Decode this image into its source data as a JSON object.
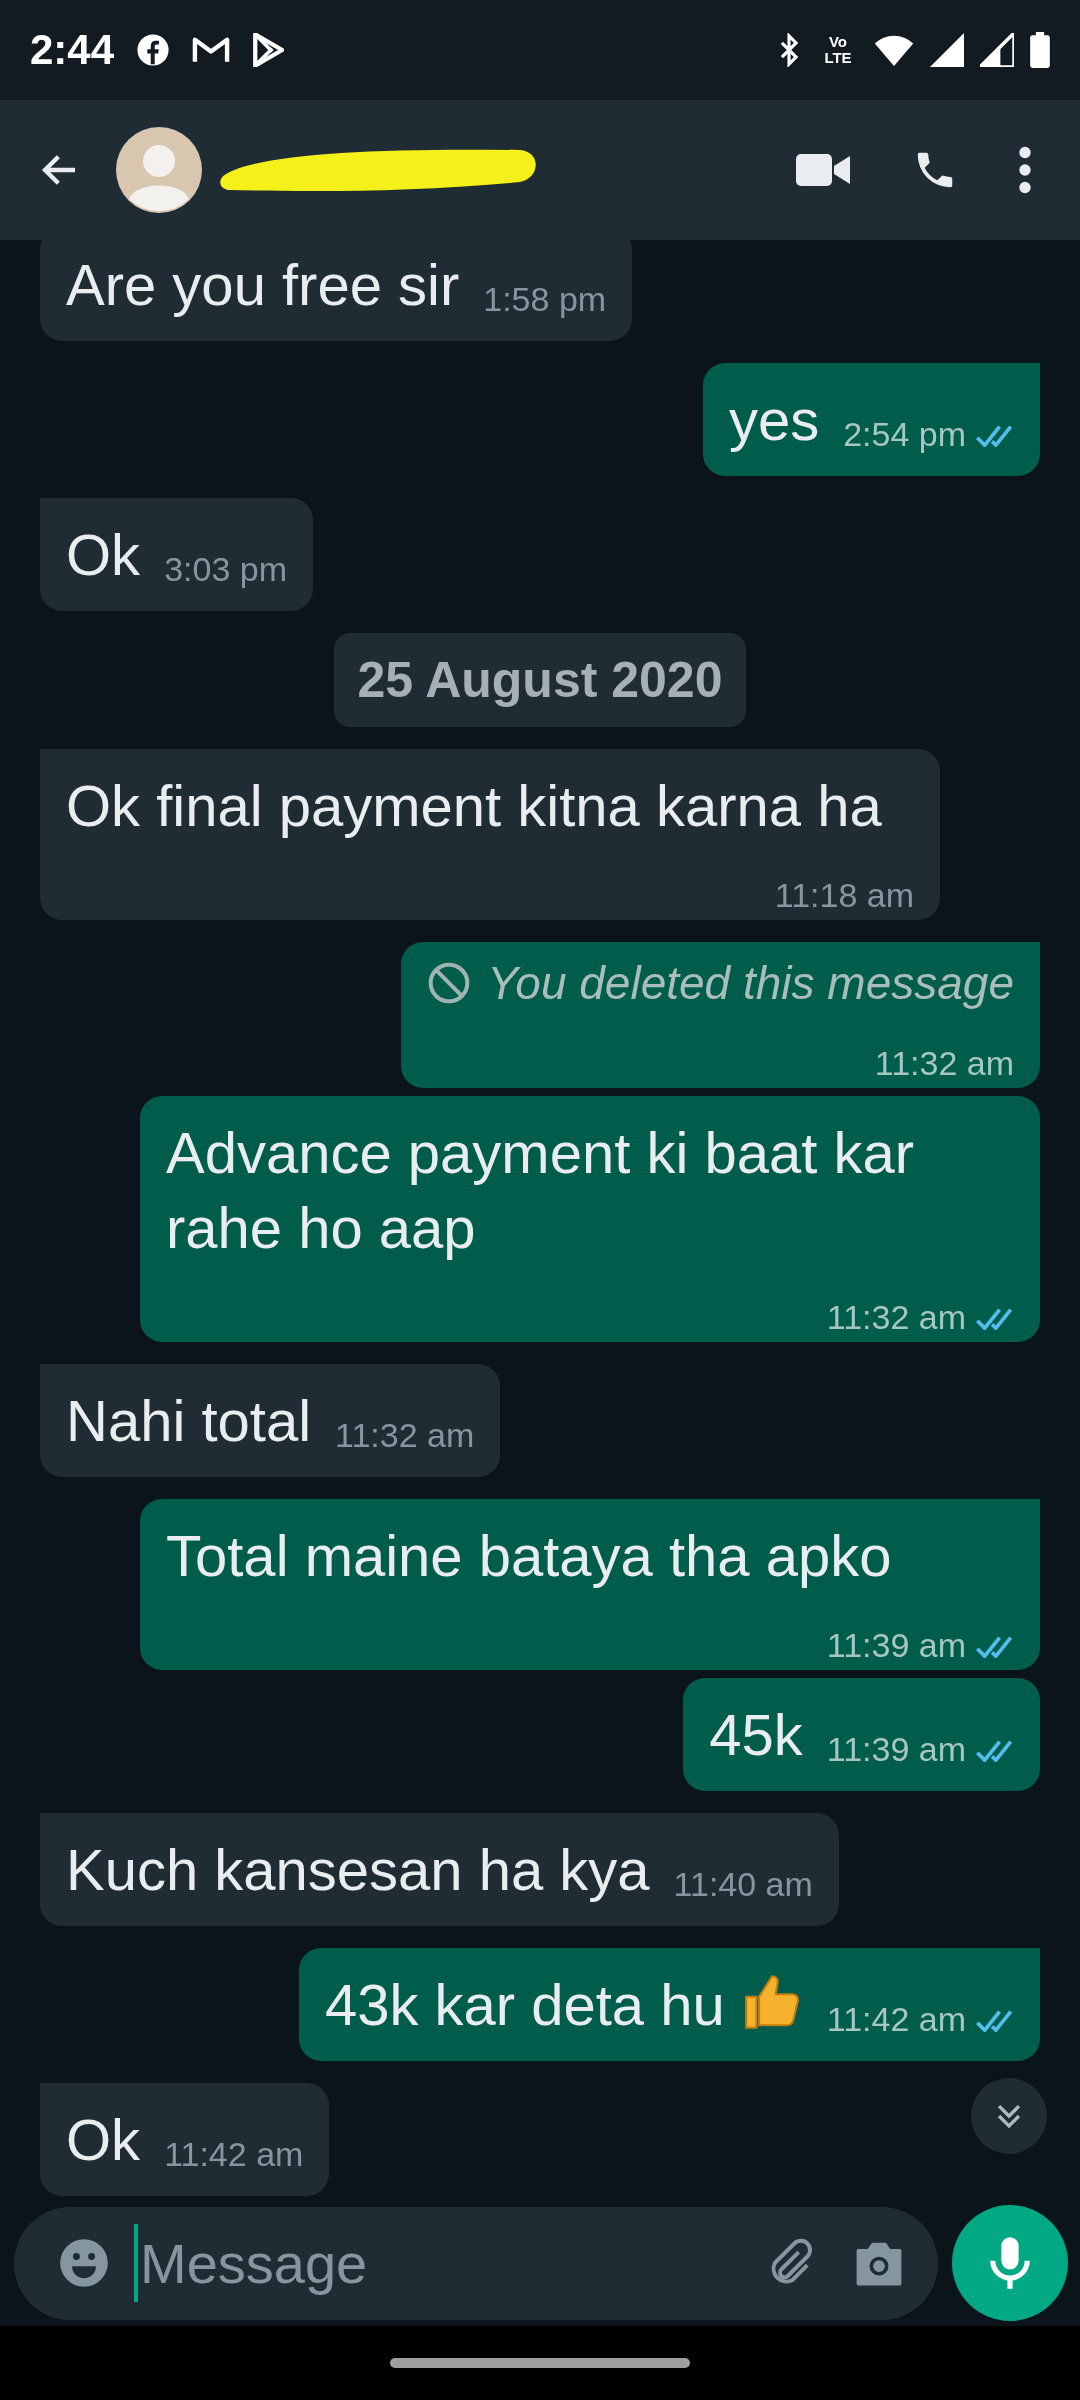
{
  "status_bar": {
    "time": "2:44",
    "network_label": "Vo LTE"
  },
  "messages": [
    {
      "kind": "incoming",
      "text": "Are you free sir",
      "time": "1:58 pm"
    },
    {
      "kind": "outgoing",
      "text": "yes",
      "time": "2:54 pm",
      "read": true,
      "tail": true
    },
    {
      "kind": "incoming",
      "text": "Ok",
      "time": "3:03 pm",
      "tail": true
    },
    {
      "kind": "date",
      "text": "25 August 2020"
    },
    {
      "kind": "incoming",
      "text": "Ok final payment kitna karna ha",
      "time": "11:18 am",
      "tail": true
    },
    {
      "kind": "deleted",
      "text": "You deleted this message",
      "time": "11:32 am",
      "tail": true
    },
    {
      "kind": "outgoing",
      "text": "Advance payment ki baat kar rahe ho aap",
      "time": "11:32 am",
      "read": true,
      "tail": false
    },
    {
      "kind": "incoming",
      "text": "Nahi total",
      "time": "11:32 am",
      "tail": true
    },
    {
      "kind": "outgoing",
      "text": "Total maine bataya tha apko",
      "time": "11:39 am",
      "read": true,
      "tail": true
    },
    {
      "kind": "outgoing",
      "text": "45k",
      "time": "11:39 am",
      "read": true,
      "tail": false
    },
    {
      "kind": "incoming",
      "text": "Kuch kansesan ha kya",
      "time": "11:40 am",
      "tail": true
    },
    {
      "kind": "outgoing",
      "text": "43k kar deta hu",
      "thumbs_up": true,
      "time": "11:42 am",
      "read": true,
      "tail": true
    },
    {
      "kind": "incoming",
      "text": "Ok",
      "time": "11:42 am",
      "tail": true
    }
  ],
  "composer": {
    "placeholder": "Message"
  }
}
